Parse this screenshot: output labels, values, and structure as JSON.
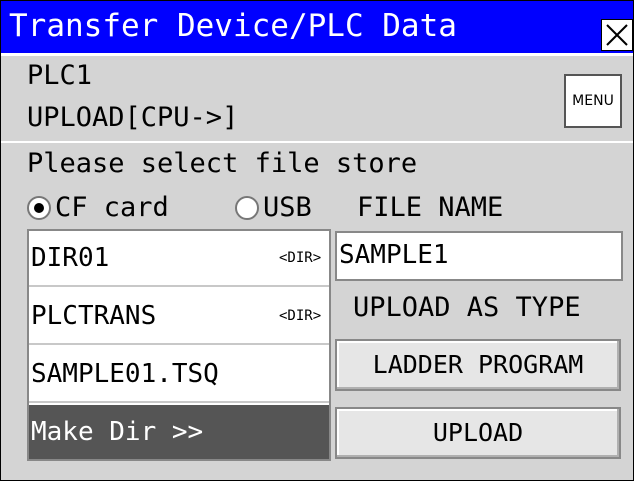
{
  "window": {
    "title": "Transfer Device/PLC Data",
    "close_icon": "close-x-icon"
  },
  "header": {
    "plc_name": "PLC1",
    "mode": "UPLOAD[CPU->]",
    "menu_label": "MENU"
  },
  "store": {
    "prompt": "Please select file store",
    "options": [
      {
        "label": "CF card",
        "selected": true
      },
      {
        "label": "USB",
        "selected": false
      }
    ]
  },
  "file_list": {
    "items": [
      {
        "name": "DIR01",
        "tag": "<DIR>"
      },
      {
        "name": "PLCTRANS",
        "tag": "<DIR>"
      },
      {
        "name": "SAMPLE01.TSQ",
        "tag": ""
      }
    ],
    "make_dir_label": "Make Dir >>"
  },
  "file_name": {
    "label": "FILE NAME",
    "value": "SAMPLE1"
  },
  "upload_type": {
    "label": "UPLOAD AS TYPE",
    "type_button": "LADDER PROGRAM"
  },
  "actions": {
    "upload_button": "UPLOAD"
  },
  "colors": {
    "titlebar": "#0000ff",
    "panel": "#d4d4d4",
    "make_dir_bg": "#555555"
  }
}
